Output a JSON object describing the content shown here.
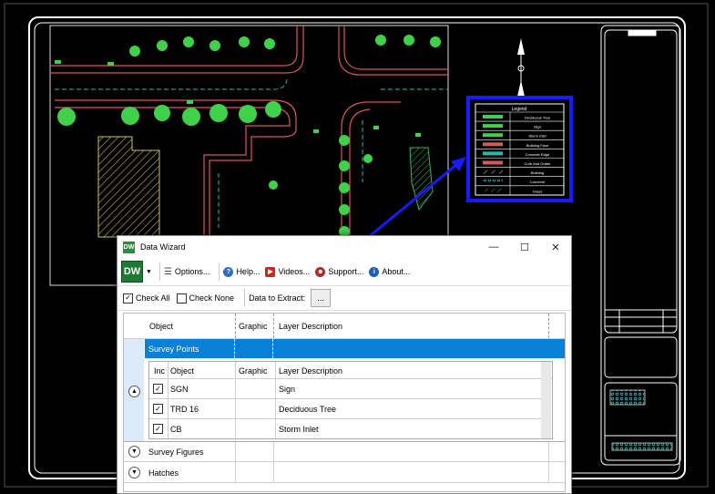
{
  "cad": {
    "legend": {
      "title": "Legend",
      "items": [
        "Deciduous Tree",
        "Sign",
        "Storm Inlet",
        "Building Face",
        "Concrete Edge",
        "Curb And Gutter",
        "Building",
        "Concrete",
        "Grass"
      ]
    }
  },
  "wizard": {
    "icon_text": "DW",
    "title": "Data Wizard",
    "minimize": "—",
    "maximize": "☐",
    "close": "✕",
    "logo": "DW",
    "toolbar": {
      "options": "Options...",
      "help": "Help...",
      "videos": "Videos...",
      "support": "Support...",
      "about": "About..."
    },
    "check_all": "Check All",
    "check_none": "Check None",
    "data_to_extract": "Data to Extract:",
    "browse": "...",
    "headers": {
      "object": "Object",
      "graphic": "Graphic",
      "layer": "Layer Description"
    },
    "groups": [
      {
        "name": "Survey Points",
        "expanded": true,
        "sub_headers": {
          "inc": "Inc",
          "object": "Object",
          "graphic": "Graphic",
          "layer": "Layer Description"
        },
        "rows": [
          {
            "checked": true,
            "object": "SGN",
            "layer": "Sign"
          },
          {
            "checked": true,
            "object": "TRD 16",
            "layer": "Deciduous Tree"
          },
          {
            "checked": true,
            "object": "CB",
            "layer": "Storm Inlet"
          }
        ]
      },
      {
        "name": "Survey Figures",
        "expanded": false
      },
      {
        "name": "Hatches",
        "expanded": false
      }
    ]
  }
}
